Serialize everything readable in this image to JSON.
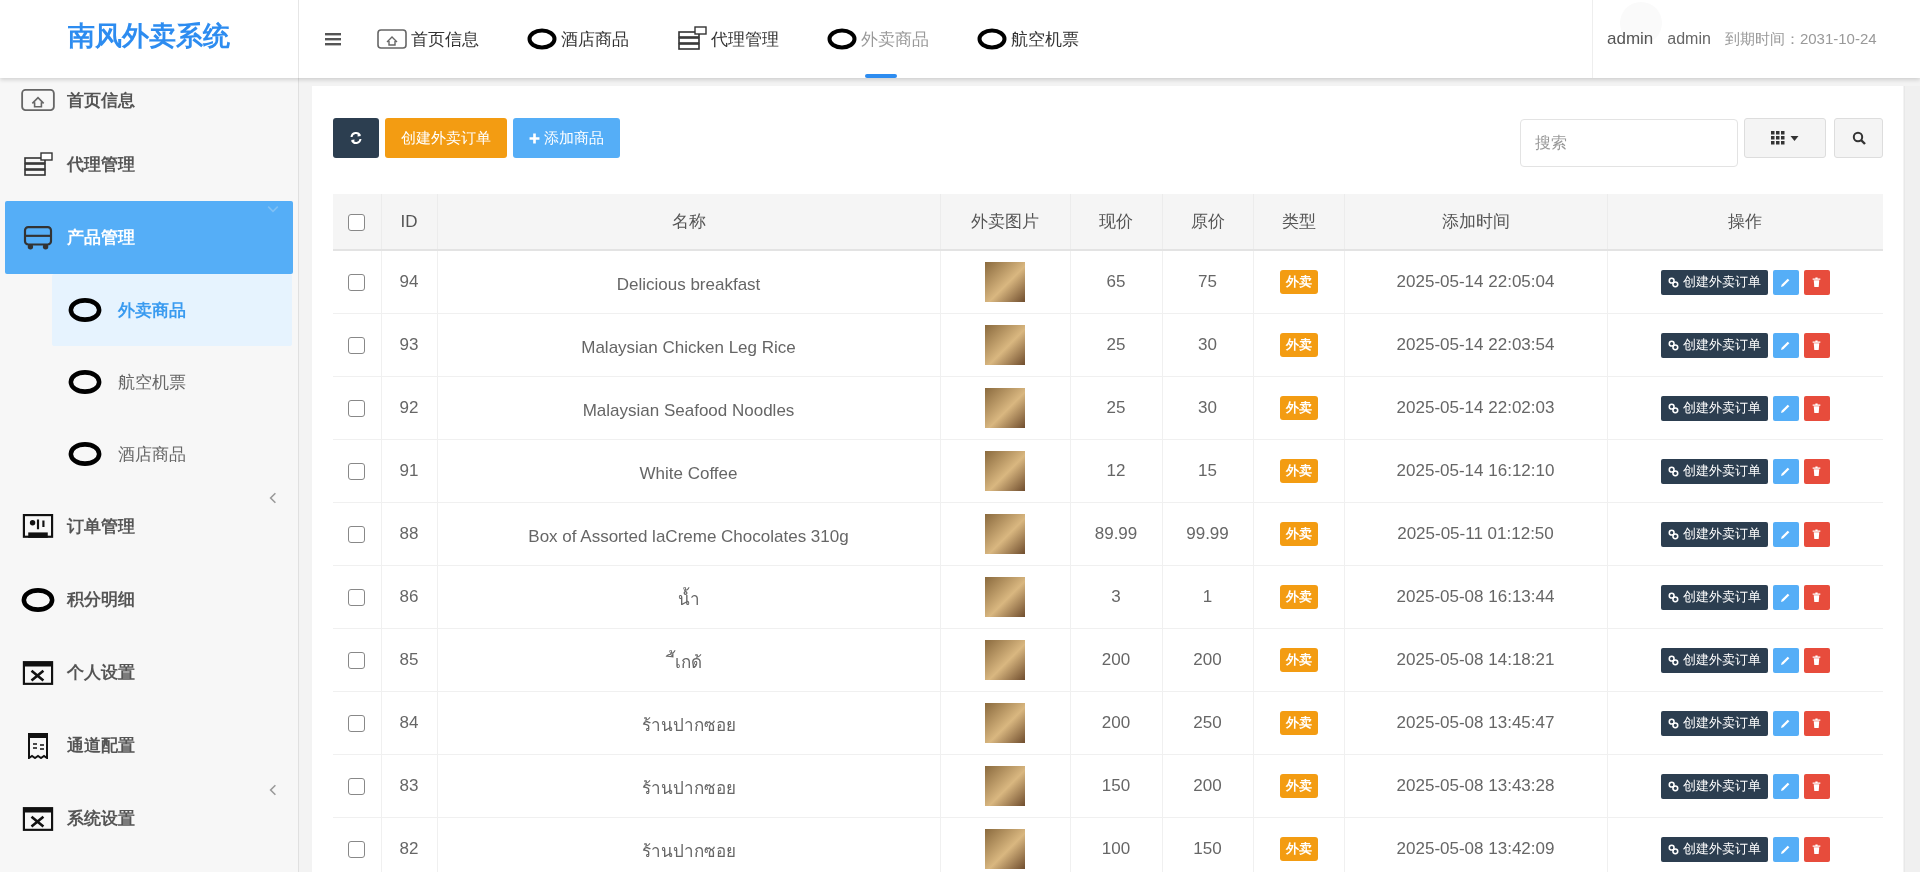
{
  "logo": "南风外卖系统",
  "topnav": {
    "items": [
      {
        "label": "首页信息",
        "selected": false
      },
      {
        "label": "酒店商品",
        "selected": false
      },
      {
        "label": "代理管理",
        "selected": false
      },
      {
        "label": "外卖商品",
        "selected": true
      },
      {
        "label": "航空机票",
        "selected": false
      }
    ]
  },
  "user": {
    "name": "admin",
    "role": "admin",
    "expiry": "到期时间：2031-10-24"
  },
  "sidebar": {
    "items": [
      {
        "label": "首页信息",
        "kind": "link",
        "selected": false
      },
      {
        "label": "代理管理",
        "kind": "link",
        "selected": false
      },
      {
        "label": "产品管理",
        "kind": "group",
        "expanded": true,
        "selected": true,
        "children": [
          {
            "label": "外卖商品",
            "selected": true
          },
          {
            "label": "航空机票",
            "selected": false
          },
          {
            "label": "酒店商品",
            "selected": false
          }
        ]
      },
      {
        "label": "订单管理",
        "kind": "group",
        "expanded": false,
        "selected": false
      },
      {
        "label": "积分明细",
        "kind": "link",
        "selected": false
      },
      {
        "label": "个人设置",
        "kind": "link",
        "selected": false
      },
      {
        "label": "通道配置",
        "kind": "link",
        "selected": false
      },
      {
        "label": "系统设置",
        "kind": "group",
        "expanded": false,
        "selected": false
      }
    ]
  },
  "toolbar": {
    "create_button": "创建外卖订单",
    "add_button": "添加商品",
    "search": {
      "placeholder": "搜索"
    }
  },
  "table": {
    "select_all": false,
    "columns": [
      "ID",
      "名称",
      "外卖图片",
      "现价",
      "原价",
      "类型",
      "添加时间",
      "操作"
    ],
    "rows": [
      {
        "checked": false,
        "id": "94",
        "name": "Delicious breakfast",
        "price": "65",
        "original": "75",
        "type": "外卖",
        "time": "2025-05-14 22:05:04",
        "action": "创建外卖订单"
      },
      {
        "checked": false,
        "id": "93",
        "name": "Malaysian Chicken Leg Rice",
        "price": "25",
        "original": "30",
        "type": "外卖",
        "time": "2025-05-14 22:03:54",
        "action": "创建外卖订单"
      },
      {
        "checked": false,
        "id": "92",
        "name": "Malaysian Seafood Noodles",
        "price": "25",
        "original": "30",
        "type": "外卖",
        "time": "2025-05-14 22:02:03",
        "action": "创建外卖订单"
      },
      {
        "checked": false,
        "id": "91",
        "name": "White Coffee",
        "price": "12",
        "original": "15",
        "type": "外卖",
        "time": "2025-05-14 16:12:10",
        "action": "创建外卖订单"
      },
      {
        "checked": false,
        "id": "88",
        "name": "Box of Assorted laCreme Chocolates 310g",
        "price": "89.99",
        "original": "99.99",
        "type": "外卖",
        "time": "2025-05-11 01:12:50",
        "action": "创建外卖订单"
      },
      {
        "checked": false,
        "id": "86",
        "name": "น้ำ",
        "price": "3",
        "original": "1",
        "type": "外卖",
        "time": "2025-05-08 16:13:44",
        "action": "创建外卖订单"
      },
      {
        "checked": false,
        "id": "85",
        "name": "ี้เกด้",
        "price": "200",
        "original": "200",
        "type": "外卖",
        "time": "2025-05-08 14:18:21",
        "action": "创建外卖订单"
      },
      {
        "checked": false,
        "id": "84",
        "name": "ร้านปากซอย",
        "price": "200",
        "original": "250",
        "type": "外卖",
        "time": "2025-05-08 13:45:47",
        "action": "创建外卖订单"
      },
      {
        "checked": false,
        "id": "83",
        "name": "ร้านปากซอย",
        "price": "150",
        "original": "200",
        "type": "外卖",
        "time": "2025-05-08 13:43:28",
        "action": "创建外卖订单"
      },
      {
        "checked": false,
        "id": "82",
        "name": "ร้านปากซอย",
        "price": "100",
        "original": "150",
        "type": "外卖",
        "time": "2025-05-08 13:42:09",
        "action": "创建外卖订单"
      }
    ]
  }
}
